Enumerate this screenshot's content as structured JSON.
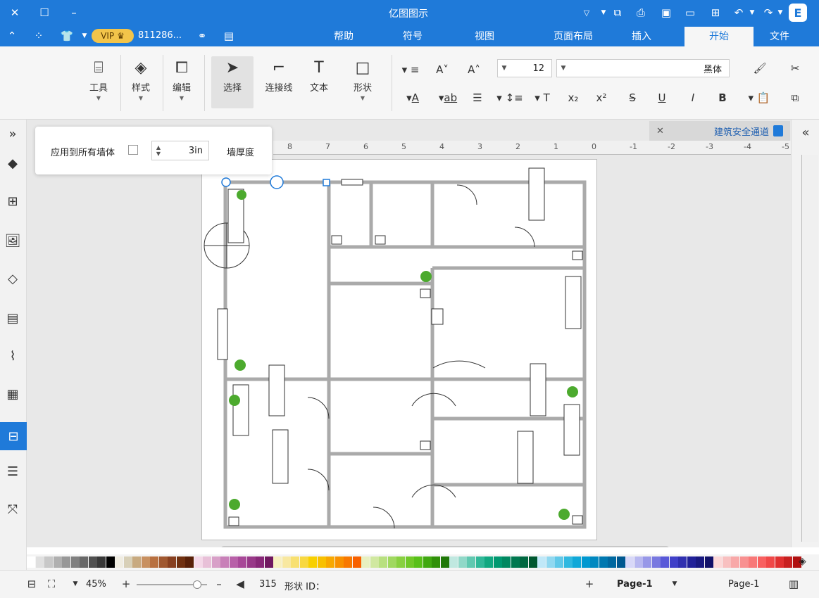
{
  "titlebar": {
    "app_title": "亿图图示",
    "colors": {
      "bar": "#1f7ad9"
    }
  },
  "menubar": {
    "tabs": [
      {
        "label": "文件"
      },
      {
        "label": "开始",
        "active": true
      },
      {
        "label": "插入"
      },
      {
        "label": "页面布局"
      },
      {
        "label": "视图"
      },
      {
        "label": "符号"
      },
      {
        "label": "帮助"
      }
    ],
    "account_text": "811286...",
    "vip_label": "VIP"
  },
  "ribbon": {
    "font_name": "黑体",
    "font_size": "12",
    "tools": [
      {
        "label": "形状",
        "icon": "square-icon"
      },
      {
        "label": "文本",
        "icon": "text-icon"
      },
      {
        "label": "连接线",
        "icon": "connector-icon"
      },
      {
        "label": "选择",
        "icon": "pointer-icon"
      },
      {
        "label": "编辑",
        "icon": "edit-icon"
      },
      {
        "label": "样式",
        "icon": "style-icon"
      },
      {
        "label": "工具",
        "icon": "tools-icon"
      }
    ]
  },
  "wall_panel": {
    "thickness_label": "墙厚度",
    "thickness_value": "3in",
    "apply_all_label": "应用到所有墙体"
  },
  "doc_tab": {
    "label": "建筑安全通道"
  },
  "ruler_labels": [
    "8",
    "7",
    "6",
    "5",
    "4",
    "3",
    "2",
    "1",
    "0",
    "-1",
    "-2",
    "-3",
    "-4",
    "-5"
  ],
  "palette": {
    "colors": [
      "#ffffff",
      "#e0e0e0",
      "#c8c8c8",
      "#b0b0b0",
      "#989898",
      "#808080",
      "#686868",
      "#505050",
      "#383838",
      "#000000",
      "#f0ede2",
      "#d8d0b8",
      "#c8aa80",
      "#c89060",
      "#b87040",
      "#a05830",
      "#884020",
      "#703010",
      "#582008",
      "#f4d8e8",
      "#e8c0d8",
      "#d8a0c8",
      "#c880b8",
      "#b860a8",
      "#a84898",
      "#983888",
      "#882878",
      "#701860",
      "#f8f0c0",
      "#f8e8a0",
      "#f8e070",
      "#f8d840",
      "#f8d000",
      "#f8c000",
      "#f8a800",
      "#f89000",
      "#f87800",
      "#f86000",
      "#e8f0c0",
      "#d0e8a0",
      "#b8e080",
      "#a0d860",
      "#88d040",
      "#70c828",
      "#58c018",
      "#40a810",
      "#309008",
      "#207808",
      "#c0e8e0",
      "#90d8c8",
      "#60c8b0",
      "#30b898",
      "#10a880",
      "#009870",
      "#008860",
      "#007850",
      "#006840",
      "#005830",
      "#c0e8f8",
      "#90d8f0",
      "#60c8e8",
      "#30b8e0",
      "#10a8d8",
      "#0098d0",
      "#0088c0",
      "#0078b0",
      "#0068a0",
      "#005890",
      "#d8d8f8",
      "#b8b8f0",
      "#9898e8",
      "#7878e0",
      "#5858d8",
      "#4040c8",
      "#3030b0",
      "#202098",
      "#181880",
      "#101068",
      "#fcd8d8",
      "#f8c0c0",
      "#f8a8a8",
      "#f89090",
      "#f87878",
      "#f86060",
      "#f04848",
      "#e03030",
      "#c82020",
      "#b01010"
    ]
  },
  "statusbar": {
    "page_selector": "Page-1",
    "page_tab": "Page-1",
    "shape_id_label": "形状 ID：",
    "shape_id_value": "315",
    "zoom_level": "45%"
  }
}
